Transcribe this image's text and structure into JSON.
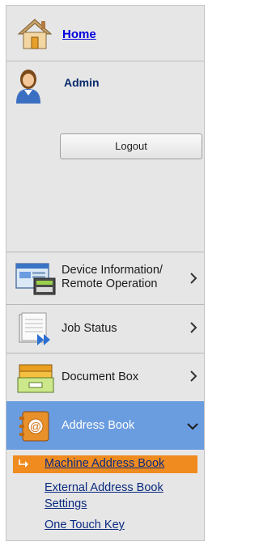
{
  "header": {
    "home_label": "Home",
    "home_icon": "house-icon"
  },
  "user": {
    "name": "Admin",
    "avatar_icon": "user-avatar-icon",
    "logout_label": "Logout"
  },
  "nav": {
    "items": [
      {
        "label_line1": "Device Information/",
        "label_line2": "Remote Operation",
        "icon": "device-info-icon",
        "expanded": false
      },
      {
        "label": "Job Status",
        "icon": "job-status-icon",
        "expanded": false
      },
      {
        "label": "Document Box",
        "icon": "document-box-icon",
        "expanded": false
      },
      {
        "label": "Address Book",
        "icon": "address-book-icon",
        "expanded": true
      }
    ]
  },
  "address_book": {
    "sub_items": [
      {
        "label": "Machine Address Book",
        "selected": true
      },
      {
        "label": "External Address Book Settings",
        "label_line1": "External Address Book",
        "label_line2": "Settings",
        "selected": false
      },
      {
        "label": "One Touch Key",
        "selected": false
      }
    ]
  },
  "colors": {
    "active_nav": "#6a9ce0",
    "selected_sub": "#ef8b1f",
    "link": "#0a2a80"
  }
}
